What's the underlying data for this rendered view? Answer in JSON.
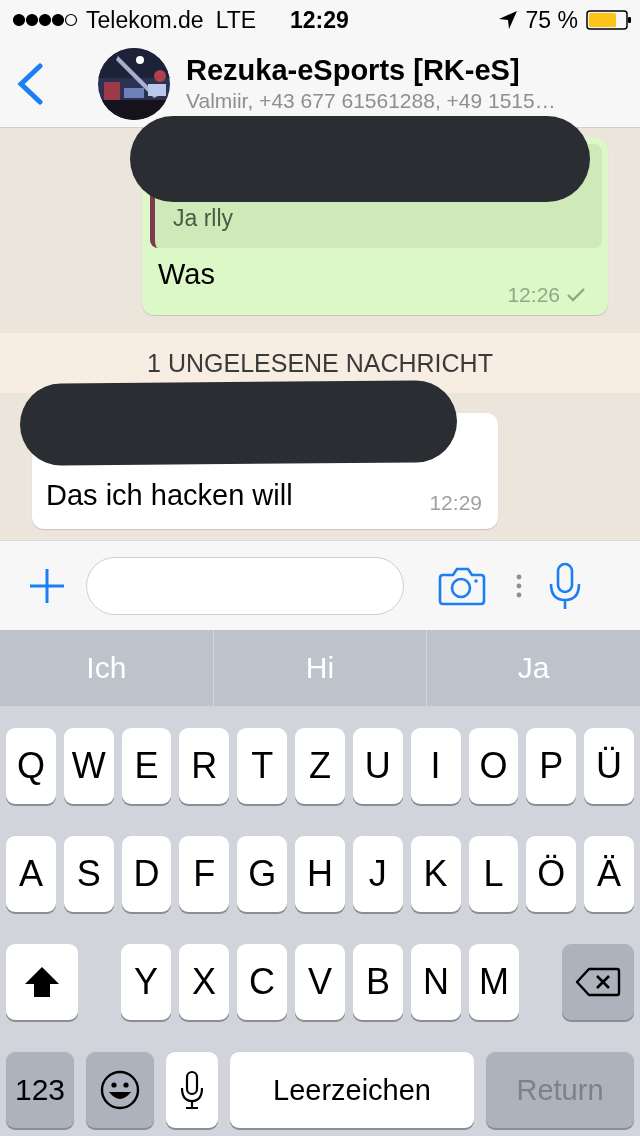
{
  "status_bar": {
    "carrier": "Telekom.de",
    "network": "LTE",
    "time": "12:29",
    "battery": "75 %"
  },
  "header": {
    "title": "Rezuka-eSports [RK-eS]",
    "subtitle": "Valmiir, +43 677 61561288, +49 1515…"
  },
  "messages": [
    {
      "kind": "outgoing",
      "quote": "Ja rlly",
      "text": "Was",
      "time": "12:26",
      "delivered": true
    },
    {
      "kind": "divider",
      "text": "1 UNGELESENE NACHRICHT"
    },
    {
      "kind": "incoming",
      "text": "Das ich hacken will",
      "time": "12:29"
    }
  ],
  "suggestions": [
    "Ich",
    "Hi",
    "Ja"
  ],
  "keyboard": {
    "top_letters": [
      "Q",
      "W",
      "E",
      "R",
      "T",
      "Z",
      "U",
      "I",
      "O",
      "P",
      "Ü"
    ],
    "middle_letters": [
      "A",
      "S",
      "D",
      "F",
      "G",
      "H",
      "J",
      "K",
      "L",
      "Ö",
      "Ä"
    ],
    "bottom_letters": [
      "Y",
      "X",
      "C",
      "V",
      "B",
      "N",
      "M"
    ],
    "numbers_key": "123",
    "space_key": "Leerzeichen",
    "return_key": "Return",
    "return_disabled": true
  }
}
